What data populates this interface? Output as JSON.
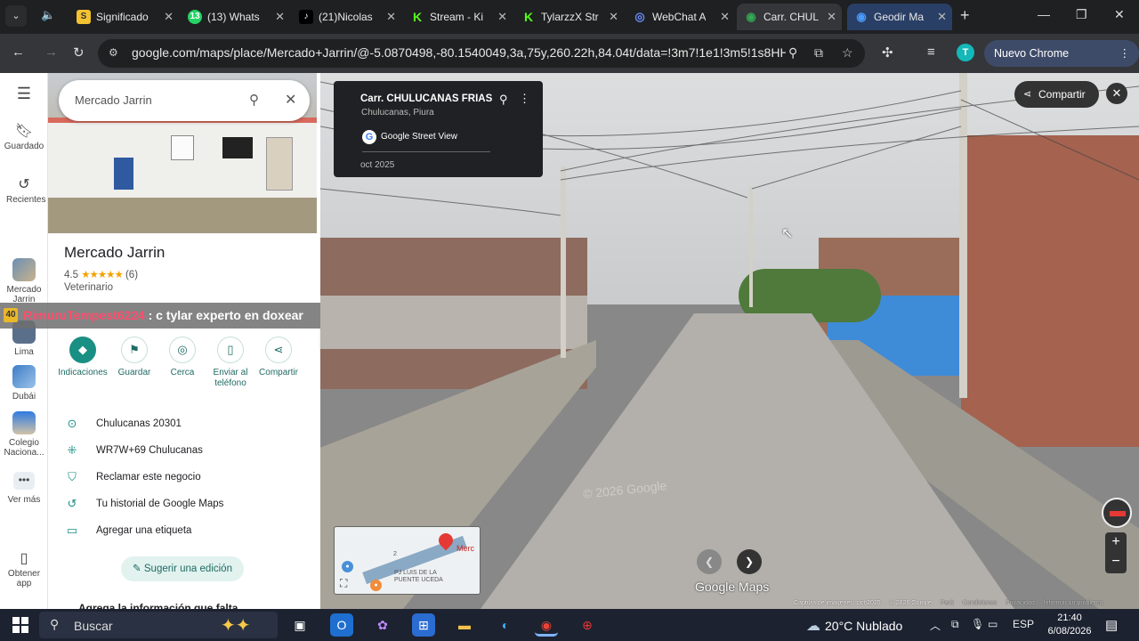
{
  "browser": {
    "tabs": [
      {
        "title": "Significado",
        "icon": "S",
        "icon_color": "#f2c230"
      },
      {
        "title": "(13) Whats",
        "icon": "13",
        "icon_color": "#25d366"
      },
      {
        "title": "(21)Nicolas",
        "icon": "♪",
        "icon_color": "#000000"
      },
      {
        "title": "Stream - Ki",
        "icon": "K",
        "icon_color": "#53fc18"
      },
      {
        "title": "TylarzzX Str",
        "icon": "K",
        "icon_color": "#53fc18"
      },
      {
        "title": "WebChat A",
        "icon": "◎",
        "icon_color": "#6c8cff"
      },
      {
        "title": "Carr. CHUL",
        "icon": "◉",
        "icon_color": "#34a853"
      },
      {
        "title": "Geodir Ma",
        "icon": "◉",
        "icon_color": "#1a73e8"
      }
    ],
    "url": "google.com/maps/place/Mercado+Jarrin/@-5.0870498,-80.1540049,3a,75y,260.22h,84.04t/data=!3m7!1e1!3m5!1s8HHp-3q...",
    "profile_initial": "T",
    "update_button": "Nuevo Chrome disponible"
  },
  "rail": {
    "saved": "Guardado",
    "recent": "Recientes",
    "recent_place": "Mercado Jarrin",
    "lima": "Lima",
    "dubai": "Dubái",
    "colegio": "Colegio Naciona...",
    "more": "Ver más",
    "get_app": "Obtener app"
  },
  "panel": {
    "search_value": "Mercado Jarrin",
    "place_name": "Mercado Jarrin",
    "rating": "4.5",
    "stars": "★★★★★",
    "reviews": "(6)",
    "category": "Veterinario",
    "actions": [
      "Indicaciones",
      "Guardar",
      "Cerca",
      "Enviar al teléfono",
      "Compartir"
    ],
    "info": [
      {
        "icon": "location-pin",
        "text": "Chulucanas 20301"
      },
      {
        "icon": "plus-code",
        "text": "WR7W+69 Chulucanas"
      },
      {
        "icon": "shield-check",
        "text": "Reclamar este negocio"
      },
      {
        "icon": "history",
        "text": "Tu historial de Google Maps"
      },
      {
        "icon": "label",
        "text": "Agregar una etiqueta"
      }
    ],
    "suggest": "Sugerir una edición",
    "more_info": "Agrega la información que falta"
  },
  "overlay": {
    "user": "RimuruTempest6224",
    "message": ": c tylar experto en doxear",
    "badge": "40"
  },
  "streetview": {
    "title": "Carr. CHULUCANAS FRIAS",
    "subtitle": "Chulucanas, Piura",
    "provider": "Google Street View",
    "date": "oct 2025",
    "share": "Compartir",
    "watermark": "© 2026 Google",
    "brand": "Google Maps",
    "minimap_label": "Merc",
    "minimap_street": "PJ LUIS DE LA PUENTE UCEDA",
    "minimap_num": "2",
    "footer": [
      "Captura de imágenes: oct 2025",
      "© 2026 Google",
      "Perú",
      "Condiciones",
      "Privacidad",
      "Informar un problema"
    ]
  },
  "taskbar": {
    "search": "Buscar",
    "weather": "20°C Nublado",
    "lang": "ESP",
    "time": "21:40",
    "date": "6/08/2026"
  }
}
